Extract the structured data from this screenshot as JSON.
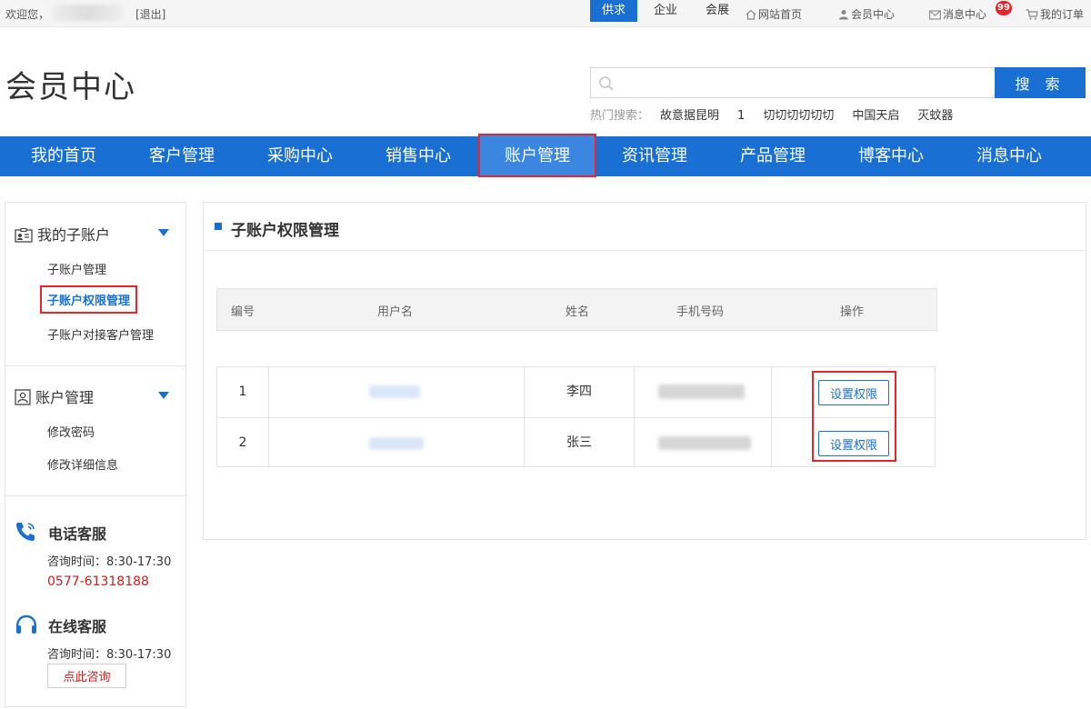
{
  "topbar": {
    "welcome": "欢迎您，",
    "logout": "[退出]",
    "links": [
      {
        "label": "网站首页",
        "icon": "home-icon"
      },
      {
        "label": "会员中心",
        "icon": "user-icon"
      },
      {
        "label": "消息中心",
        "icon": "mail-icon"
      },
      {
        "label": "我的订单",
        "icon": "cart-icon"
      }
    ],
    "message_badge": "99"
  },
  "header": {
    "title": "会员中心",
    "search_tabs": [
      "供求",
      "企业",
      "会展"
    ],
    "search_placeholder": "",
    "search_button": "搜 索",
    "hot_label": "热门搜索：",
    "hot_keywords": [
      "故意据昆明",
      "1",
      "切切切切切切",
      "中国天启",
      "灭蚊器"
    ]
  },
  "nav": {
    "items": [
      "我的首页",
      "客户管理",
      "采购中心",
      "销售中心",
      "账户管理",
      "资讯管理",
      "产品管理",
      "博客中心",
      "消息中心"
    ],
    "active_index": 4
  },
  "sidebar": {
    "groups": [
      {
        "title": "我的子账户",
        "icon": "id-card-icon",
        "items": [
          "子账户管理",
          "子账户权限管理",
          "子账户对接客户管理"
        ],
        "active": 1
      },
      {
        "title": "账户管理",
        "icon": "account-icon",
        "items": [
          "修改密码",
          "修改详细信息"
        ]
      }
    ],
    "phone_service": {
      "title": "电话客服",
      "hours": "咨询时间：8:30-17:30",
      "phone": "0577-61318188"
    },
    "online_service": {
      "title": "在线客服",
      "hours": "咨询时间：8:30-17:30",
      "button": "点此咨询"
    }
  },
  "main": {
    "title": "子账户权限管理",
    "columns": [
      "编号",
      "用户名",
      "姓名",
      "手机号码",
      "操作"
    ],
    "rows": [
      {
        "id": "1",
        "name": "李四",
        "action": "设置权限"
      },
      {
        "id": "2",
        "name": "张三",
        "action": "设置权限"
      }
    ]
  },
  "colors": {
    "primary": "#1a6fd3",
    "highlight": "#e8242c",
    "phone": "#d61c1c"
  }
}
